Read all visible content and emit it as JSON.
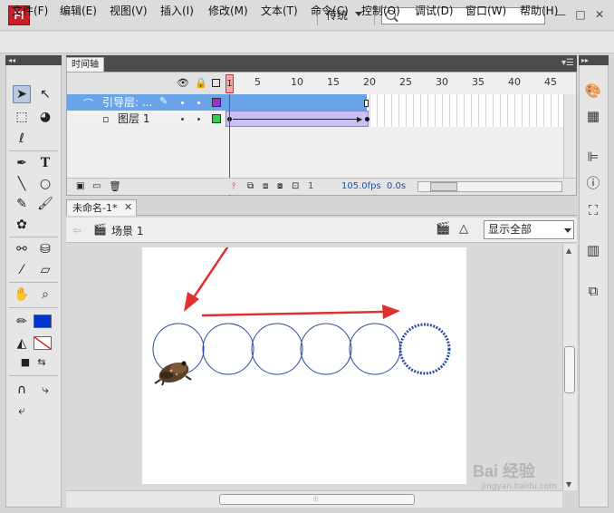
{
  "app": {
    "logo_text": "Fl",
    "workspace": "传统"
  },
  "menu": [
    "文件(F)",
    "编辑(E)",
    "视图(V)",
    "插入(I)",
    "修改(M)",
    "文本(T)",
    "命令(C)",
    "控制(O)",
    "调试(D)",
    "窗口(W)",
    "帮助(H)"
  ],
  "timeline": {
    "tab_label": "时间轴",
    "frame_numbers": [
      "1",
      "5",
      "10",
      "15",
      "20",
      "25",
      "30",
      "35",
      "40",
      "45"
    ],
    "layers": [
      {
        "name": "引导层: ...",
        "selected": true
      },
      {
        "name": "图层 1",
        "selected": false
      }
    ],
    "footer": {
      "current_frame": "1",
      "fps": "105.0fps",
      "time": "0.0s"
    }
  },
  "document": {
    "tab_label": "未命名-1*",
    "scene": "场景 1",
    "zoom": "显示全部"
  },
  "colors": {
    "stroke": "#000000",
    "fill": "#0033cc",
    "guide_layer_row": "#6aa4e8",
    "tween_frames": "#c9c2f2",
    "arrow": "#e03030",
    "circle": "#2a4aa0"
  },
  "watermark": {
    "text": "Bai 经验",
    "sub": "jingyan.baidu.com"
  }
}
